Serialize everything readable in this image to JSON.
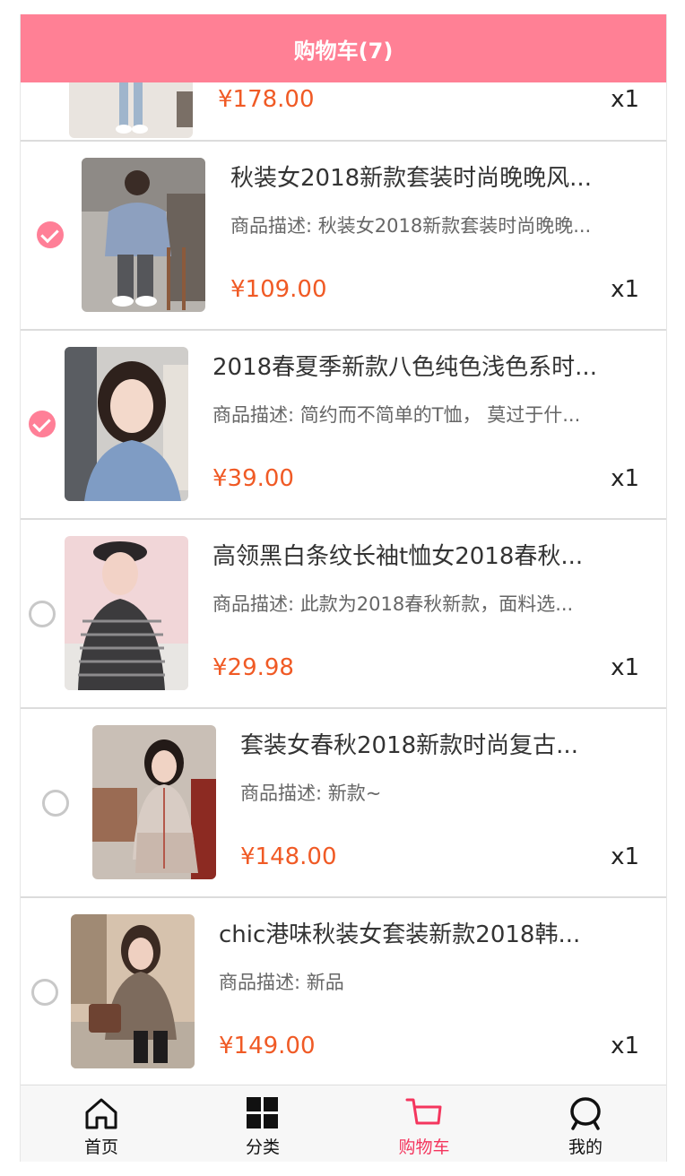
{
  "header": {
    "title": "购物车(7)"
  },
  "colors": {
    "header_bg": "#ff8095",
    "price": "#f05a25",
    "check_on": "#ff7f97",
    "tab_active": "#f4365e"
  },
  "partial_item": {
    "price": "¥178.00",
    "qty": "x1"
  },
  "items": [
    {
      "title": "秋装女2018新款套装时尚晚晚风...",
      "desc": "商品描述: 秋装女2018新款套装时尚晚晚...",
      "price": "¥109.00",
      "qty": "x1",
      "checked": true
    },
    {
      "title": "2018春夏季新款八色纯色浅色系时...",
      "desc": "商品描述: 简约而不简单的T恤， 莫过于什...",
      "price": "¥39.00",
      "qty": "x1",
      "checked": true
    },
    {
      "title": "高领黑白条纹长袖t恤女2018春秋...",
      "desc": "商品描述: 此款为2018春秋新款，面料选...",
      "price": "¥29.98",
      "qty": "x1",
      "checked": false
    },
    {
      "title": "套装女春秋2018新款时尚复古...",
      "desc": "商品描述: 新款~",
      "price": "¥148.00",
      "qty": "x1",
      "checked": false
    },
    {
      "title": "chic港味秋装女套装新款2018韩...",
      "desc": "商品描述: 新品",
      "price": "¥149.00",
      "qty": "x1",
      "checked": false
    }
  ],
  "tabbar": [
    {
      "label": "首页",
      "icon": "home-icon",
      "active": false
    },
    {
      "label": "分类",
      "icon": "grid-icon",
      "active": false
    },
    {
      "label": "购物车",
      "icon": "cart-icon",
      "active": true
    },
    {
      "label": "我的",
      "icon": "profile-icon",
      "active": false
    }
  ]
}
